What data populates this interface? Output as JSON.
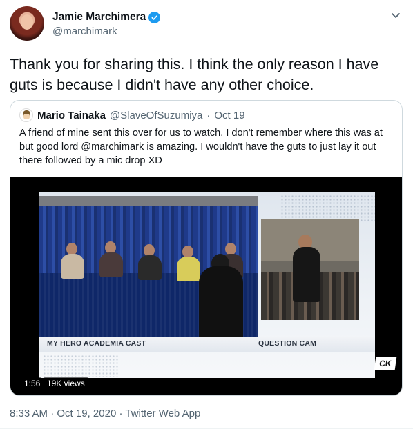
{
  "tweet": {
    "author": {
      "display_name": "Jamie Marchimera",
      "handle": "@marchimark",
      "verified": true
    },
    "more_icon": "chevron-down-icon",
    "text": "Thank you for sharing this. I think the only reason I have guts is because I didn't have any other choice.",
    "footer": {
      "time": "8:33 AM",
      "date": "Oct 19, 2020",
      "source": "Twitter Web App",
      "separator": " · "
    }
  },
  "quote": {
    "author_name": "Mario Tainaka",
    "author_handle": "@SlaveOfSuzumiya",
    "date": "Oct 19",
    "separator": " · ",
    "text": "A friend of mine sent this over for us to watch, I don't remember where this was at but good lord @marchimark is amazing. I wouldn't have the guts to just lay it out there followed by a mic drop XD",
    "video": {
      "duration": "1:56",
      "views": "19K views",
      "lower_third_left": "MY HERO ACADEMIA CAST",
      "lower_third_right": "QUESTION CAM",
      "logo_text": "CK"
    }
  },
  "colors": {
    "text_primary": "#0f1419",
    "text_secondary": "#536471",
    "verified_blue": "#1d9bf0",
    "border": "#cfd9de"
  }
}
